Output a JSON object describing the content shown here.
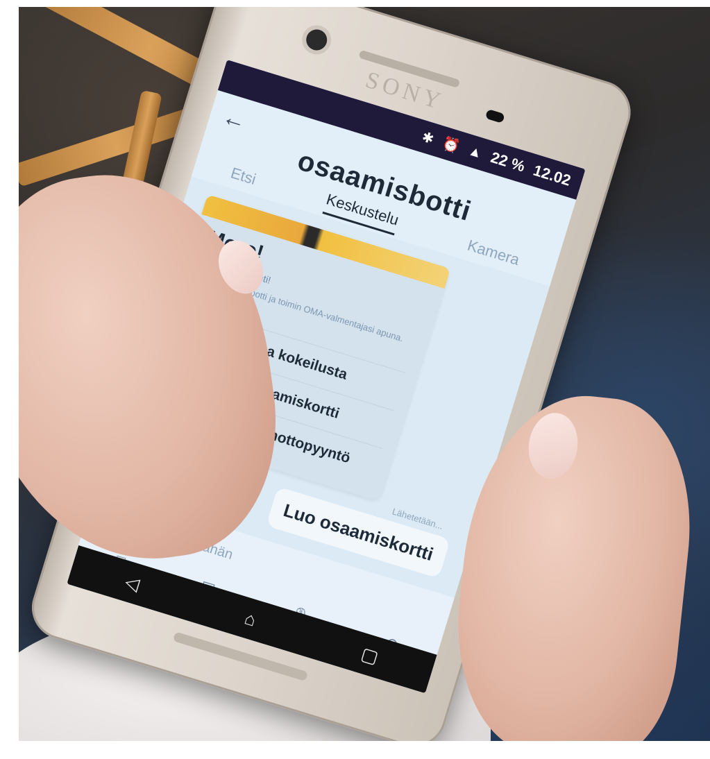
{
  "status": {
    "bluetooth_icon": "bluetooth-icon",
    "alarm_icon": "alarm-icon",
    "signal_icon": "signal-icon",
    "battery": "22 %",
    "time": "12.02"
  },
  "device": {
    "brand": "SONY"
  },
  "app": {
    "back_icon": "←",
    "title": "osaamisbotti",
    "tabs": [
      {
        "label": "Etsi"
      },
      {
        "label": "Keskustelu"
      },
      {
        "label": "Kamera"
      }
    ]
  },
  "chat": {
    "card": {
      "greeting": "Moro!",
      "subtitle": "Uutta työtä kohti!",
      "description": "Olen Osaamisbotti ja toimin OMA-valmentajasi apuna. Autan sinua kar...",
      "options": [
        {
          "label": "Tietoa kokeilusta"
        },
        {
          "label": "Luo osaamiskortti"
        },
        {
          "label": "Jätä yhteydenottopyyntö"
        }
      ]
    },
    "sent_message": "Luo osaamiskortti",
    "sending_status": "Lähetetään...",
    "chevron": "⌄"
  },
  "composer": {
    "emoji_icon": "☺",
    "placeholder": "Kirjoita viesti tähän",
    "tools": [
      "□",
      "▣",
      "🎙",
      "⊙"
    ]
  },
  "navbar": {
    "back": "◁",
    "home": "⌂",
    "recents": "▢"
  }
}
